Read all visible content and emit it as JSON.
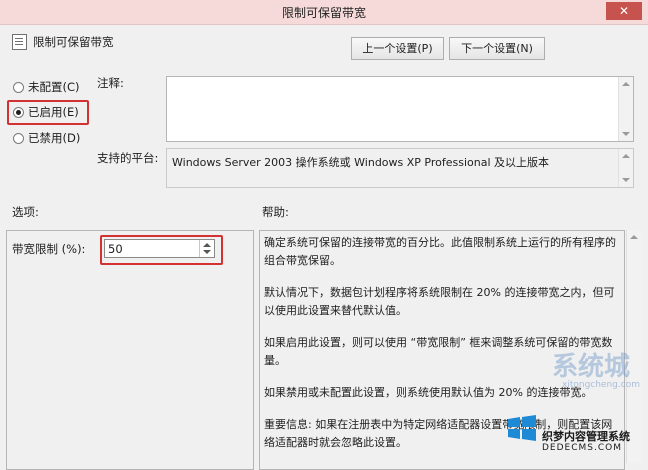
{
  "window": {
    "title": "限制可保留带宽",
    "close_glyph": "✕"
  },
  "header": {
    "policy_name": "限制可保留带宽",
    "prev_button": "上一个设置(P)",
    "next_button": "下一个设置(N)"
  },
  "state": {
    "options": [
      {
        "label": "未配置(C)",
        "checked": false
      },
      {
        "label": "已启用(E)",
        "checked": true
      },
      {
        "label": "已禁用(D)",
        "checked": false
      }
    ]
  },
  "comment": {
    "label": "注释:",
    "value": ""
  },
  "platform": {
    "label": "支持的平台:",
    "value": "Windows Server 2003 操作系统或 Windows XP Professional 及以上版本"
  },
  "options_section": {
    "label": "选项:",
    "field_label": "带宽限制 (%):",
    "field_value": "50"
  },
  "help_section": {
    "label": "帮助:",
    "paragraphs": [
      "确定系统可保留的连接带宽的百分比。此值限制系统上运行的所有程序的组合带宽保留。",
      "默认情况下，数据包计划程序将系统限制在 20% 的连接带宽之内，但可以使用此设置来替代默认值。",
      "如果启用此设置，则可以使用 “带宽限制” 框来调整系统可保留的带宽数量。",
      "如果禁用或未配置此设置，则系统使用默认值为 20% 的连接带宽。",
      "重要信息: 如果在注册表中为特定网络适配器设置带宽限制，则配置该网络适配器时就会忽略此设置。"
    ]
  },
  "watermark": {
    "brand": "系统城",
    "domain": "xitongcheng.com",
    "site_name": "织梦内容管理系统",
    "site_domain": "DEDECMS.COM"
  },
  "colors": {
    "highlight_red": "#d33232",
    "title_bar": "#f6dada",
    "close_button": "#c7534e"
  }
}
